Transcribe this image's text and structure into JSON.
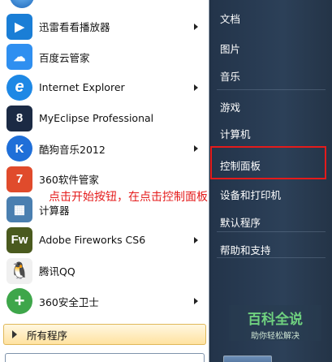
{
  "programs": [
    {
      "label": "迅雷看看播放器",
      "icon": "xunlei-player-icon",
      "color": "#1a7ed6",
      "glyph": "▶",
      "arrow": true
    },
    {
      "label": "百度云管家",
      "icon": "baidu-cloud-icon",
      "color": "#2f8ff0",
      "glyph": "☁",
      "arrow": false
    },
    {
      "label": "Internet Explorer",
      "icon": "ie-icon",
      "color": "#1e88e5",
      "glyph": "e",
      "arrow": true
    },
    {
      "label": "MyEclipse Professional",
      "icon": "myeclipse-icon",
      "color": "#1b2a44",
      "glyph": "8",
      "arrow": false
    },
    {
      "label": "酷狗音乐2012",
      "icon": "kugou-icon",
      "color": "#1f6fd8",
      "glyph": "K",
      "arrow": true
    },
    {
      "label": "360软件管家",
      "icon": "360-software-icon",
      "color": "#e04b2c",
      "glyph": "7",
      "arrow": false
    },
    {
      "label": "计算器",
      "icon": "calculator-icon",
      "color": "#4a7fb0",
      "glyph": "▦",
      "arrow": false
    },
    {
      "label": "Adobe Fireworks CS6",
      "icon": "fireworks-icon",
      "color": "#4a5a1e",
      "glyph": "Fw",
      "arrow": true
    },
    {
      "label": "腾讯QQ",
      "icon": "qq-icon",
      "color": "#f0f0f0",
      "glyph": "🐧",
      "arrow": false
    },
    {
      "label": "360安全卫士",
      "icon": "360-security-icon",
      "color": "#3ea64a",
      "glyph": "+",
      "arrow": true
    }
  ],
  "all_programs": "所有程序",
  "right_items": [
    "文档",
    "图片",
    "音乐",
    "游戏",
    "计算机",
    "控制面板",
    "设备和打印机",
    "默认程序",
    "帮助和支持"
  ],
  "annotation": "点击开始按钮，在点击控制面板",
  "watermark": {
    "title": "百科全说",
    "subtitle": "助你轻松解决"
  },
  "highlight_color": "#e41b1b"
}
